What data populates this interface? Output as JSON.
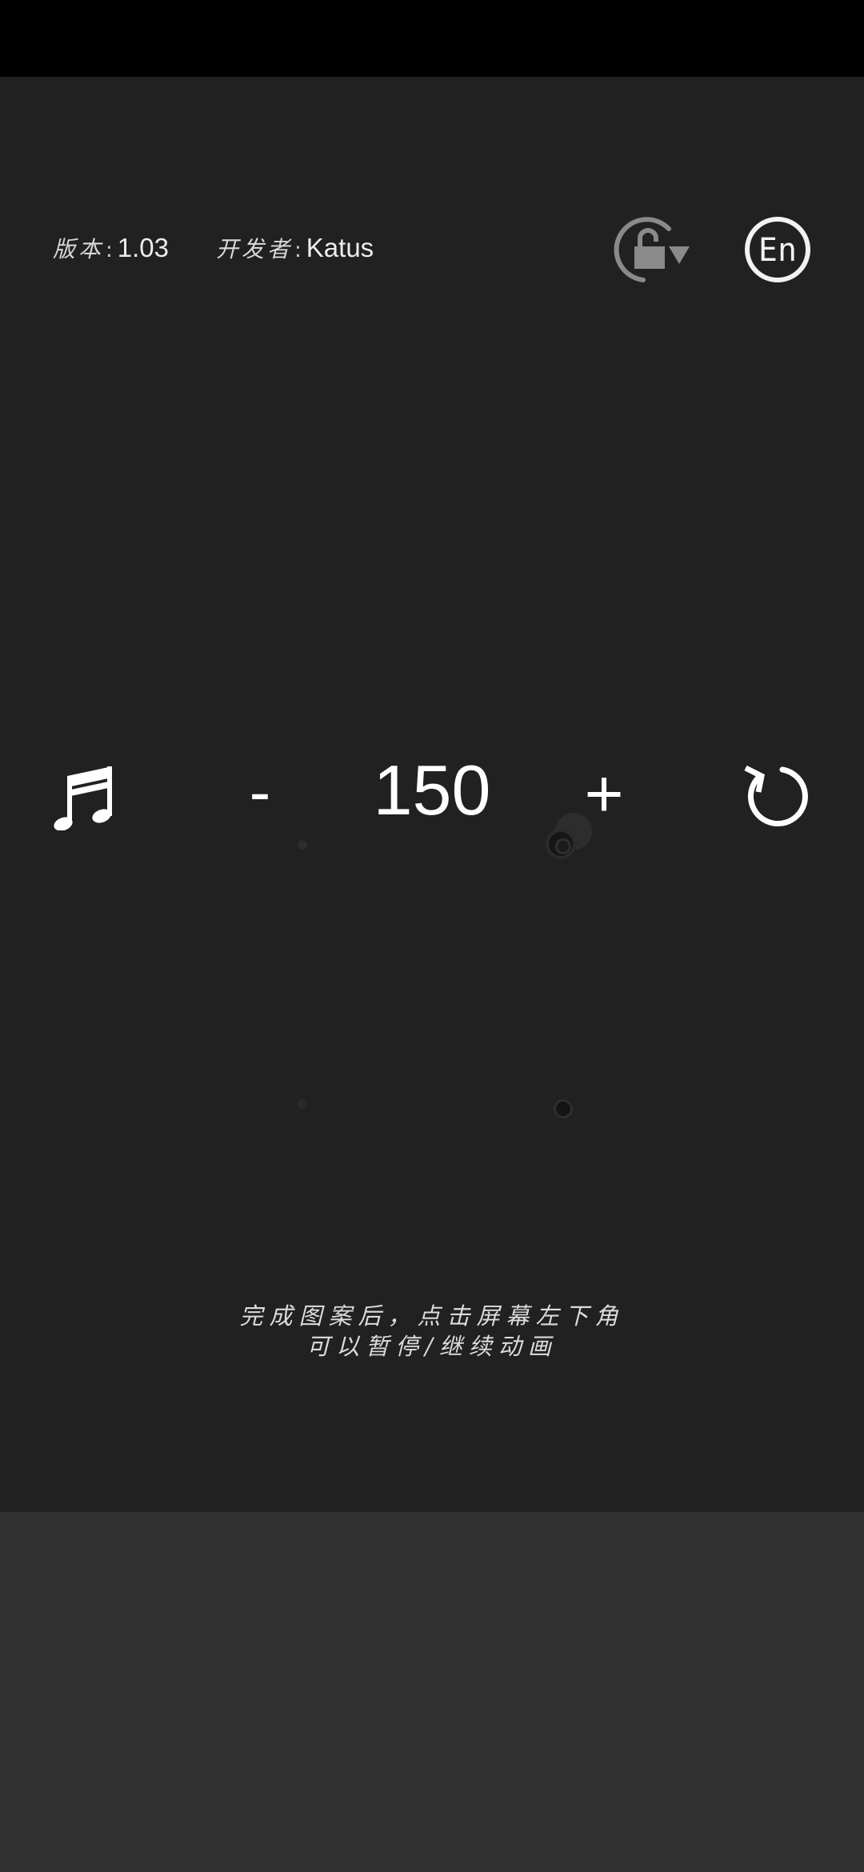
{
  "header": {
    "version_label": "版本",
    "version_colon": ":",
    "version_value": "1.03",
    "developer_label": "开发者",
    "developer_colon": ":",
    "developer_value": "Katus",
    "lang_button_label": "En",
    "icons": {
      "rotation_lock": "rotation-unlock-icon",
      "language": "language-en-icon"
    }
  },
  "controls": {
    "minus_label": "-",
    "speed_value": "150",
    "plus_label": "+",
    "icons": {
      "music": "music-note-icon",
      "reset": "reset-icon"
    }
  },
  "hint": {
    "line1": "完成图案后，点击屏幕左下角",
    "line2": "可以暂停/继续动画"
  },
  "colors": {
    "background": "#212121",
    "status_bar": "#000000",
    "bottom_area": "#313131",
    "foreground": "#ffffff",
    "muted_icon": "#8a8a8a"
  }
}
